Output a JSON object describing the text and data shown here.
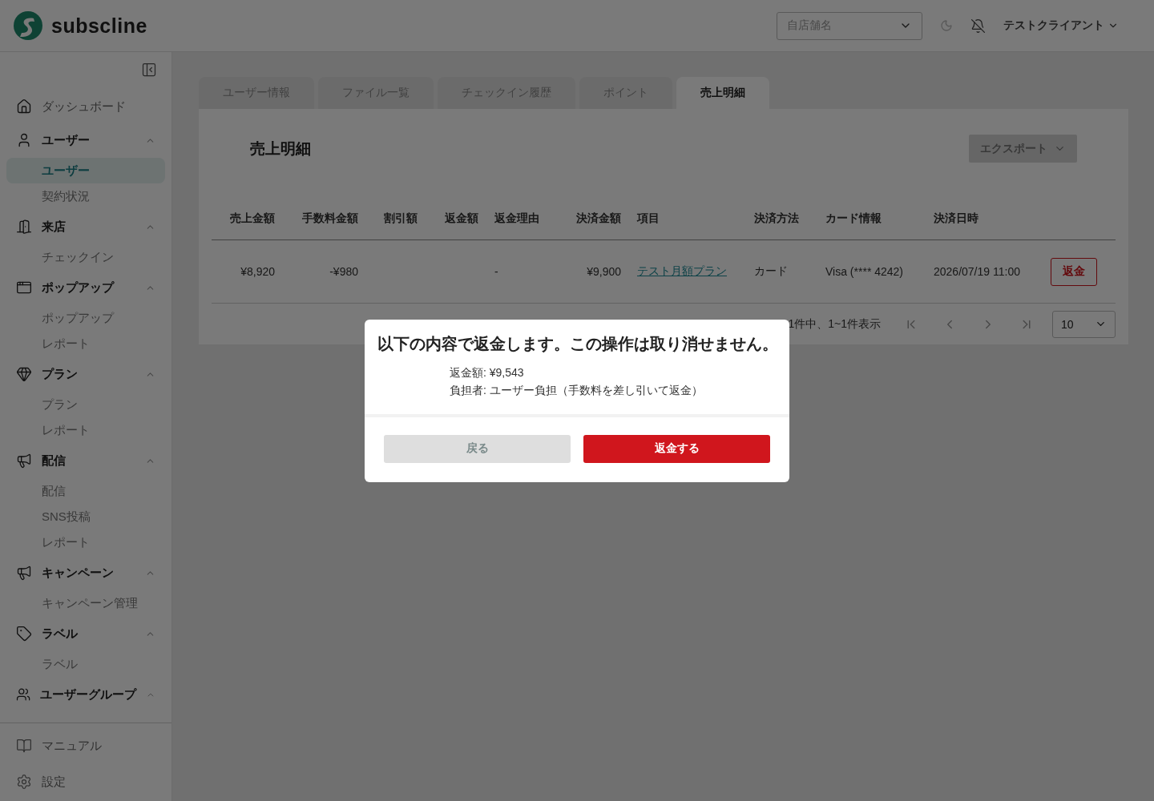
{
  "header": {
    "logo": "subscline",
    "store_select": {
      "placeholder": "自店舗名"
    },
    "user_menu": "テストクライアント"
  },
  "sidebar": {
    "items": [
      {
        "kind": "link",
        "label": "ダッシュボード",
        "selected": false
      },
      {
        "kind": "group",
        "label": "ユーザー",
        "expanded": true,
        "children": [
          {
            "label": "ユーザー",
            "selected": true
          },
          {
            "label": "契約状況",
            "selected": false
          }
        ]
      },
      {
        "kind": "group",
        "label": "来店",
        "expanded": true,
        "children": [
          {
            "label": "チェックイン",
            "selected": false
          }
        ]
      },
      {
        "kind": "group",
        "label": "ポップアップ",
        "expanded": true,
        "children": [
          {
            "label": "ポップアップ",
            "selected": false
          },
          {
            "label": "レポート",
            "selected": false
          }
        ]
      },
      {
        "kind": "group",
        "label": "プラン",
        "expanded": true,
        "children": [
          {
            "label": "プラン",
            "selected": false
          },
          {
            "label": "レポート",
            "selected": false
          }
        ]
      },
      {
        "kind": "group",
        "label": "配信",
        "expanded": true,
        "children": [
          {
            "label": "配信",
            "selected": false
          },
          {
            "label": "SNS投稿",
            "selected": false
          },
          {
            "label": "レポート",
            "selected": false
          }
        ]
      },
      {
        "kind": "group",
        "label": "キャンペーン",
        "expanded": true,
        "children": [
          {
            "label": "キャンペーン管理",
            "selected": false
          }
        ]
      },
      {
        "kind": "group",
        "label": "ラベル",
        "expanded": true,
        "children": [
          {
            "label": "ラベル",
            "selected": false
          }
        ]
      },
      {
        "kind": "group",
        "label": "ユーザーグループ",
        "expanded": true
      }
    ],
    "footer": [
      "マニュアル",
      "設定"
    ]
  },
  "tabs": [
    {
      "label": "ユーザー情報",
      "selected": false
    },
    {
      "label": "ファイル一覧",
      "selected": false
    },
    {
      "label": "チェックイン履歴",
      "selected": false
    },
    {
      "label": "ポイント",
      "selected": false
    },
    {
      "label": "売上明細",
      "selected": true
    }
  ],
  "panel": {
    "title": "売上明細",
    "export_button": "エクスポート",
    "table": {
      "columns": [
        "売上金額",
        "手数料金額",
        "割引額",
        "返金額",
        "返金理由",
        "決済金額",
        "項目",
        "決済方法",
        "カード情報",
        "決済日時"
      ],
      "rows": [
        {
          "cells": [
            "¥8,920",
            "-¥980",
            "",
            "",
            "-",
            "¥9,900",
            "テスト月額プラン",
            "カード",
            "Visa (**** 4242)",
            "2026/07/19 11:00"
          ],
          "action": "返金"
        }
      ]
    },
    "pagination": {
      "summary": "1件中、1~1件表示",
      "page_size": "10"
    }
  },
  "dialog": {
    "title": "以下の内容で返金します。この操作は取り消せません。",
    "lines": [
      "返金額: ¥9,543",
      "負担者: ユーザー負担（手数料を差し引いて返金）"
    ],
    "cancel": "戻る",
    "confirm": "返金する"
  }
}
